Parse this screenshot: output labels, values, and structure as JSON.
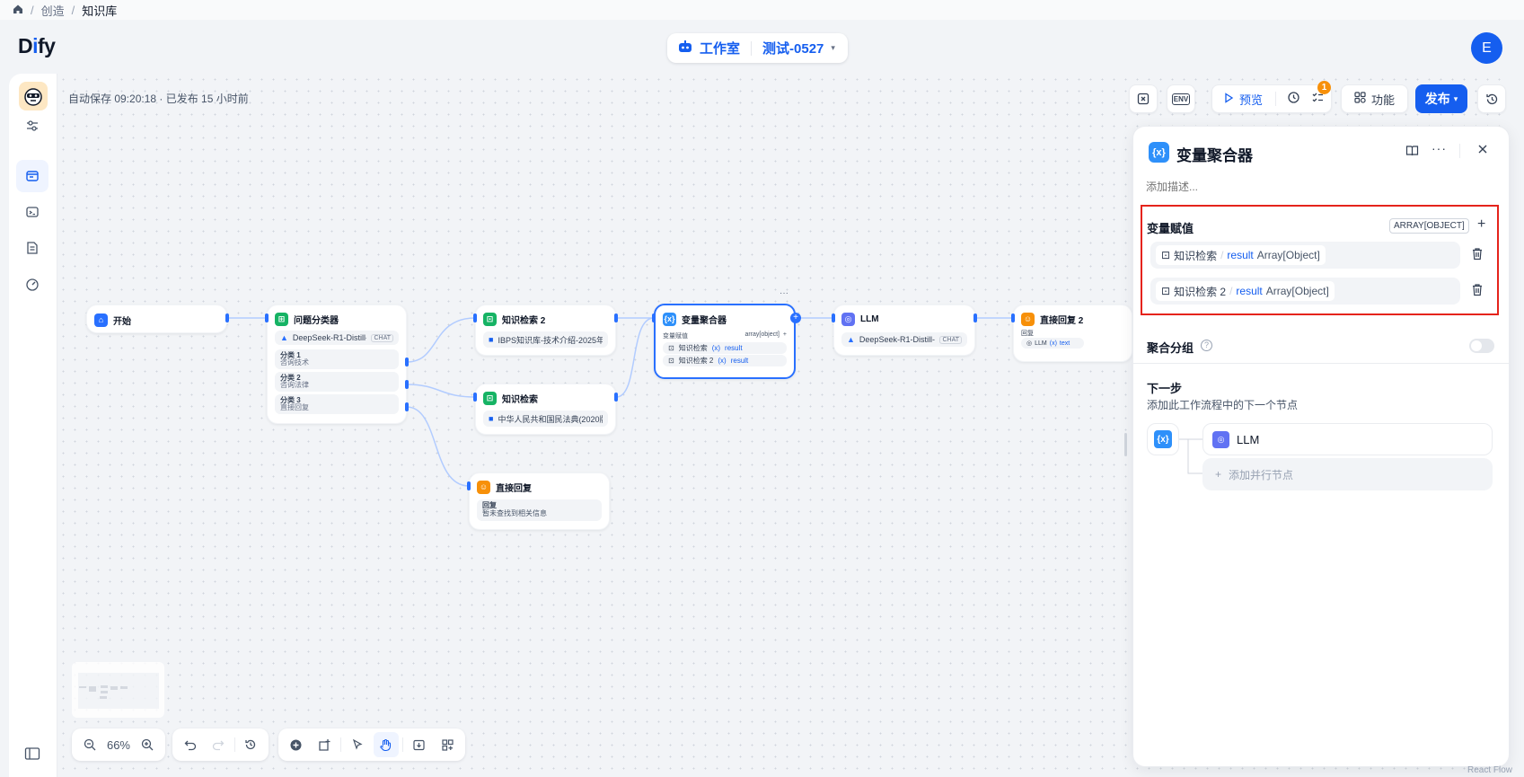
{
  "breadcrumb": {
    "items": [
      "创造",
      "知识库"
    ]
  },
  "logo": {
    "prefix": "D",
    "i": "i",
    "suffix": "fy"
  },
  "header": {
    "studio_label": "工作室",
    "app_name": "测试-0527",
    "avatar_letter": "E"
  },
  "autosave_text": "自动保存 09:20:18 · 已发布 15 小时前",
  "toolbar": {
    "env_label": "ENV",
    "preview_label": "预览",
    "checklist_badge": "1",
    "features_label": "功能",
    "publish_label": "发布"
  },
  "nodes": {
    "start": {
      "title": "开始"
    },
    "classifier": {
      "title": "问题分类器",
      "model": "DeepSeek-R1-Distill-...",
      "model_tag": "CHAT",
      "classes": [
        {
          "name": "分类 1",
          "desc": "咨询技术"
        },
        {
          "name": "分类 2",
          "desc": "咨询法律"
        },
        {
          "name": "分类 3",
          "desc": "直接回复"
        }
      ]
    },
    "kr2": {
      "title": "知识检索 2",
      "dataset": "IBPS知识库-技术介绍-2025年3..."
    },
    "kr1": {
      "title": "知识检索",
      "dataset": "中华人民共和国民法典(2020版)"
    },
    "answer1": {
      "title": "直接回复",
      "label": "回复",
      "text": "暂未查找到相关信息"
    },
    "aggregator": {
      "title": "变量聚合器",
      "label": "变量赋值",
      "type": "array[object]",
      "vars": [
        {
          "node": "知识检索",
          "var": "result"
        },
        {
          "node": "知识检索 2",
          "var": "result"
        }
      ]
    },
    "llm": {
      "title": "LLM",
      "model": "DeepSeek-R1-Distill-...",
      "model_tag": "CHAT"
    },
    "answer2": {
      "title": "直接回复 2",
      "label": "回复",
      "ref_node": "LLM",
      "ref_var": "text"
    }
  },
  "panel": {
    "title": "变量聚合器",
    "desc_placeholder": "添加描述...",
    "assign_label": "变量赋值",
    "type_badge": "ARRAY[OBJECT]",
    "vars": [
      {
        "node": "知识检索",
        "var": "result",
        "type": "Array[Object]"
      },
      {
        "node": "知识检索 2",
        "var": "result",
        "type": "Array[Object]"
      }
    ],
    "group_label": "聚合分组",
    "next_title": "下一步",
    "next_desc": "添加此工作流程中的下一个节点",
    "next_node": "LLM",
    "add_parallel": "添加并行节点"
  },
  "zoom": {
    "value": "66%"
  },
  "watermark": "React Flow",
  "colors": {
    "accent": "#155eef",
    "highlight": "#e5231b",
    "green": "#16b364",
    "orange": "#f79009",
    "indigo": "#6172f3"
  }
}
